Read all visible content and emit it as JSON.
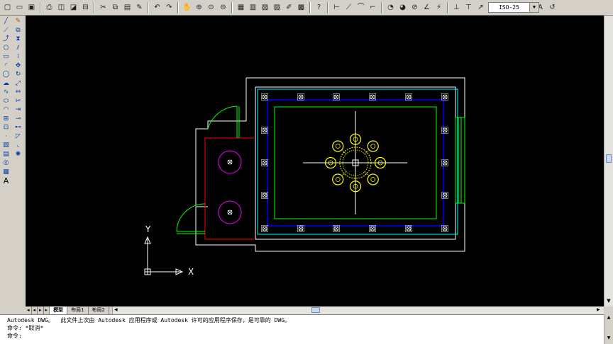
{
  "toolbar": {
    "icons": [
      "new-icon",
      "open-icon",
      "save-icon",
      "print-icon",
      "preview-icon",
      "publish-icon",
      "plot-icon",
      "cut-icon",
      "copy-icon",
      "paste-icon",
      "match-icon",
      "undo-icon",
      "redo-icon",
      "pan-icon",
      "zoom-realtime-icon",
      "zoom-window-icon",
      "zoom-previous-icon",
      "properties-icon",
      "design-center-icon",
      "tool-palette-icon",
      "sheet-set-icon",
      "markup-icon",
      "calc-icon",
      "help-icon"
    ],
    "dim_icons": [
      "linear-dim-icon",
      "aligned-dim-icon",
      "arc-length-icon",
      "ordinate-dim-icon",
      "radius-dim-icon",
      "jogged-icon",
      "diameter-dim-icon",
      "angular-dim-icon",
      "quick-dim-icon",
      "baseline-dim-icon",
      "continue-dim-icon",
      "qleader-icon",
      "tolerance-icon",
      "center-mark-icon",
      "dimedit-icon",
      "dimtedit-icon",
      "dim-update-icon"
    ],
    "dim_style_value": "ISO-25"
  },
  "tabs": {
    "model": "模型",
    "layout1": "布局1",
    "layout2": "布局2"
  },
  "command": {
    "line1": "Autodesk DWG。  此文件上次由 Autodesk 应用程序或 Autodesk 许可的应用程序保存，是可靠的 DWG。",
    "line2": "命令: *取消*",
    "prompt": "命令:"
  },
  "ucs": {
    "x_label": "X",
    "y_label": "Y"
  },
  "colors": {
    "canvas": "#000000",
    "wall": "#ffffff",
    "door": "#00ff00",
    "cyan": "#00ffff",
    "blue": "#0000ff",
    "red": "#ff0000",
    "magenta": "#ff00ff",
    "yellow": "#ffff00"
  }
}
